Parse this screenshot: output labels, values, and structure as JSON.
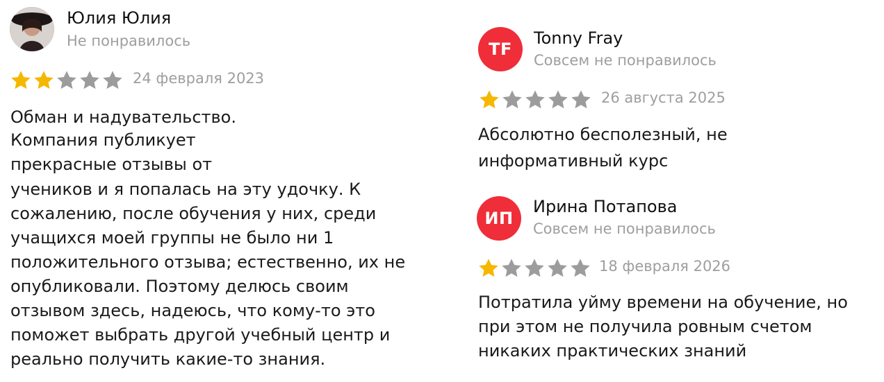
{
  "reviews": [
    {
      "author": "Юлия Юлия",
      "rating_label": "Не понравилось",
      "avatar": "photo",
      "rating": 2,
      "date": "24 февраля 2023",
      "text_lines": [
        "Обман и надувательство.",
        "Компания публикует",
        "прекрасные отзывы от",
        "учеников и я попалась на эту удочку. К",
        "сожалению, после обучения у них, среди",
        "учащихся моей группы не было ни 1",
        "положительного отзыва; естественно, их не",
        "опубликовали. Поэтому делюсь своим",
        "отзывом здесь, надеюсь, что кому-то это",
        "поможет выбрать другой учебный центр и",
        "реально получить какие-то знания."
      ]
    },
    {
      "author": "Tonny Fray",
      "initials": "TF",
      "rating_label": "Совсем не понравилось",
      "rating": 1,
      "date": "26 августа 2025",
      "text_lines": [
        "Абсолютно бесполезный, не",
        "информативный курс"
      ]
    },
    {
      "author": "Ирина Потапова",
      "initials": "ИП",
      "rating_label": "Совсем не понравилось",
      "rating": 1,
      "date": "18 февраля 2026",
      "text_lines": [
        "Потратила уйму времени на обучение, но",
        "при этом не получила ровным счетом",
        "никаких практических знаний"
      ]
    }
  ],
  "colors": {
    "star_filled": "#f5b700",
    "star_empty": "#9c9c9c",
    "avatar_initials_bg": "#ef2e39",
    "secondary_text": "#9e9e9e"
  }
}
